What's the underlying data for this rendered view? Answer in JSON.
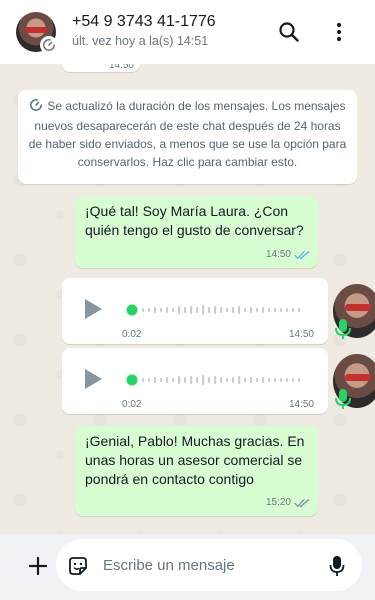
{
  "header": {
    "contact_name": "+54 9 3743 41-1776",
    "last_seen": "últ. vez hoy a la(s) 14:51",
    "icons": [
      "search-icon",
      "menu-dots-icon"
    ]
  },
  "chat": {
    "previous_message_time": "14:50",
    "system_message": "Se actualizó la duración de los mensajes. Los mensajes nuevos desaparecerán de este chat después de 24 horas de haber sido enviados, a menos que se use la opción para conservarlos. Haz clic para cambiar esto.",
    "messages": [
      {
        "direction": "out",
        "text": "¡Qué tal! Soy María Laura. ¿Con quién tengo el gusto de conversar?",
        "time": "14:50",
        "status": "read"
      },
      {
        "direction": "in",
        "type": "voice",
        "duration": "0:02",
        "time": "14:50"
      },
      {
        "direction": "in",
        "type": "voice",
        "duration": "0:02",
        "time": "14:50"
      },
      {
        "direction": "out",
        "text": "¡Genial, Pablo! Muchas gracias. En unas horas un asesor comercial se pondrá en contacto contigo",
        "time": "15:20",
        "status": "delivered"
      }
    ]
  },
  "composer": {
    "placeholder": "Escribe un mensaje",
    "icons": [
      "plus-icon",
      "sticker-icon",
      "microphone-icon"
    ]
  },
  "colors": {
    "header_bg": "#ffffff",
    "chat_bg": "#efeae2",
    "outgoing_bubble": "#d9fdd3",
    "incoming_bubble": "#ffffff",
    "read_ticks": "#53bdeb",
    "voice_dot": "#25d366",
    "composer_bg": "#f0f2f5"
  }
}
